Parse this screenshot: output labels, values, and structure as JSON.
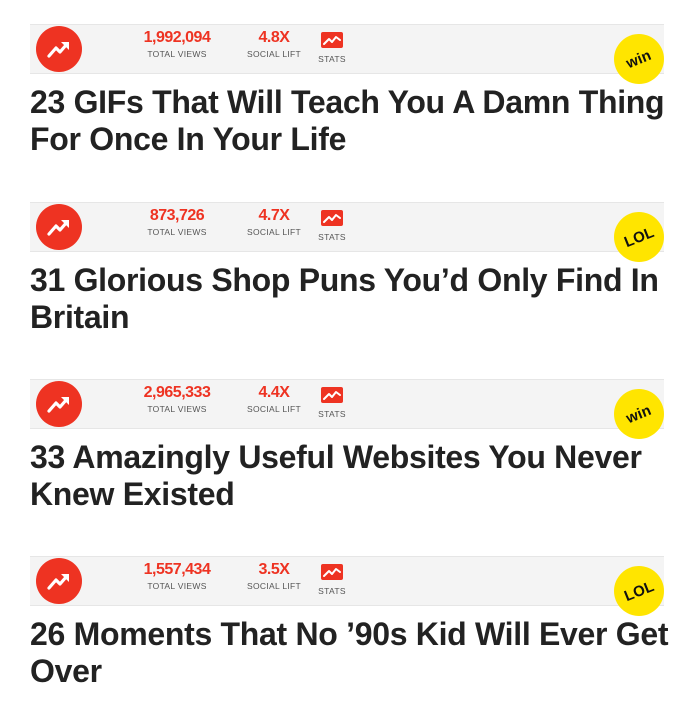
{
  "colors": {
    "accent": "#ee3322",
    "badge_yellow": "#ffe500",
    "bar_bg": "#f4f4f4"
  },
  "icons": {
    "trend": "trending-arrow-icon",
    "stats": "stats-chart-icon"
  },
  "labels": {
    "total_views": "TOTAL VIEWS",
    "social_lift": "SOCIAL LIFT",
    "stats": "STATS"
  },
  "posts": [
    {
      "views": "1,992,094",
      "lift": "4.8X",
      "badge": "win",
      "headline": "23 GIFs That Will Teach You A Damn Thing For Once In Your Life"
    },
    {
      "views": "873,726",
      "lift": "4.7X",
      "badge": "LOL",
      "headline": "31 Glorious Shop Puns You’d Only Find In Britain"
    },
    {
      "views": "2,965,333",
      "lift": "4.4X",
      "badge": "win",
      "headline": "33 Amazingly Useful Websites You Never Knew Existed"
    },
    {
      "views": "1,557,434",
      "lift": "3.5X",
      "badge": "LOL",
      "headline": "26 Moments That No ’90s Kid Will Ever Get Over"
    }
  ]
}
